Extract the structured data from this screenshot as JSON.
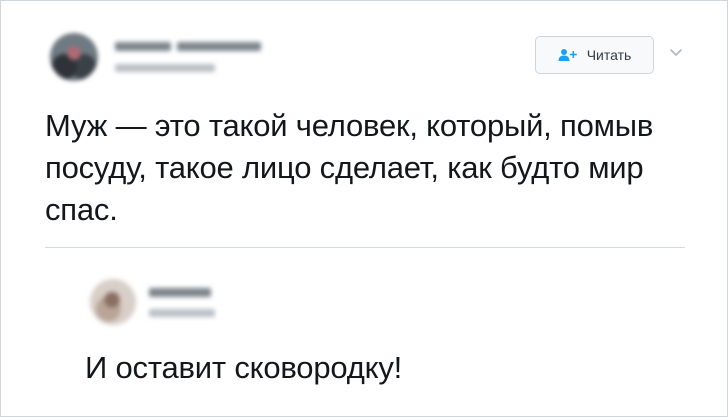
{
  "tweet": {
    "follow_button_label": "Читать",
    "text": "Муж — это такой человек, который, помыв посуду, такое лицо сделает, как будто мир спас.",
    "icons": {
      "follow": "person-add-icon",
      "menu": "chevron-down-icon"
    }
  },
  "reply": {
    "text": "И оставит сковородку!"
  },
  "colors": {
    "accent": "#1da1f2",
    "text": "#14171a",
    "border": "#cfd6dc"
  }
}
